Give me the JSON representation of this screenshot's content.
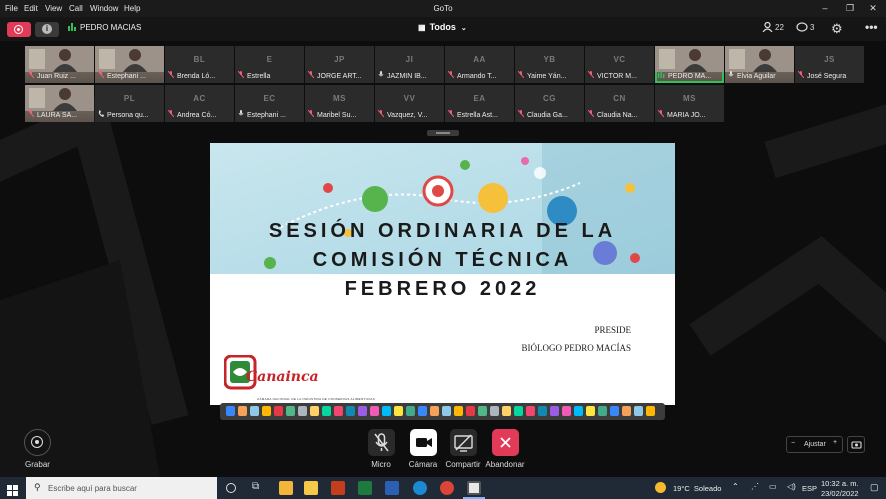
{
  "menu": [
    "File",
    "Edit",
    "View",
    "Call",
    "Window",
    "Help"
  ],
  "window_title": "GoTo",
  "topbar": {
    "speaker": "PEDRO MACIAS",
    "view": "Todos",
    "participants_count": "22",
    "chat_count": "3"
  },
  "participants_row1": [
    {
      "initials": "",
      "name": "Juan Ruiz ...",
      "status": "muted",
      "video": true
    },
    {
      "initials": "",
      "name": "Estephani ...",
      "status": "muted",
      "video": true
    },
    {
      "initials": "BL",
      "name": "Brenda Ló...",
      "status": "muted",
      "video": false
    },
    {
      "initials": "E",
      "name": "Estrella",
      "status": "muted",
      "video": false
    },
    {
      "initials": "JP",
      "name": "JORGE ART...",
      "status": "muted",
      "video": false
    },
    {
      "initials": "JI",
      "name": "JAZMIN IB...",
      "status": "mic",
      "video": false
    },
    {
      "initials": "AA",
      "name": "Armando T...",
      "status": "muted",
      "video": false
    },
    {
      "initials": "YB",
      "name": "Yaime Yán...",
      "status": "muted",
      "video": false
    },
    {
      "initials": "VC",
      "name": "VICTOR M...",
      "status": "muted",
      "video": false
    },
    {
      "initials": "",
      "name": "PEDRO MA...",
      "status": "speaking",
      "video": true
    },
    {
      "initials": "",
      "name": "Elvia Aguilar",
      "status": "mic",
      "video": true
    },
    {
      "initials": "JS",
      "name": "José Segura",
      "status": "muted",
      "video": false
    }
  ],
  "participants_row2": [
    {
      "initials": "",
      "name": "LAURA SA...",
      "status": "muted",
      "video": true
    },
    {
      "initials": "PL",
      "name": "Persona qu...",
      "status": "phone",
      "video": false
    },
    {
      "initials": "AC",
      "name": "Andrea Có...",
      "status": "muted",
      "video": false
    },
    {
      "initials": "EC",
      "name": "Estephani ...",
      "status": "mic",
      "video": false
    },
    {
      "initials": "MS",
      "name": "Maribel Su...",
      "status": "muted",
      "video": false
    },
    {
      "initials": "VV",
      "name": "Vazquez, V...",
      "status": "muted",
      "video": false
    },
    {
      "initials": "EA",
      "name": "Estrella Ast...",
      "status": "muted",
      "video": false
    },
    {
      "initials": "CG",
      "name": "Claudia Ga...",
      "status": "muted",
      "video": false
    },
    {
      "initials": "CN",
      "name": "Claudia Na...",
      "status": "muted",
      "video": false
    },
    {
      "initials": "MS",
      "name": "MARIA JO...",
      "status": "muted",
      "video": false
    }
  ],
  "slide": {
    "title_lines": [
      "SESIÓN ORDINARIA DE LA",
      "COMISIÓN TÉCNICA",
      "FEBRERO 2022"
    ],
    "preside_label": "PRESIDE",
    "preside_name": "BIÓLOGO PEDRO MACÍAS",
    "logo_text": "Canainca",
    "logo_subtitle": "CÁMARA NACIONAL DE LA INDUSTRIA DE CONSERVAS ALIMENTICIAS"
  },
  "controls": {
    "grabar": "Grabar",
    "micro": "Micro",
    "camara": "Cámara",
    "compartir": "Compartir",
    "abandonar": "Abandonar",
    "zoom_label": "Ajustar"
  },
  "taskbar": {
    "search_placeholder": "Escribe aquí para buscar",
    "weather": "19°C  Soleado",
    "language": "ESP",
    "time": "10:32 a. m.",
    "date": "23/02/2022"
  },
  "colors": {
    "leave_red": "#e23b5a",
    "speaking_green": "#32c05a",
    "muted_red": "#f25f74",
    "logo_red": "#c72328"
  }
}
